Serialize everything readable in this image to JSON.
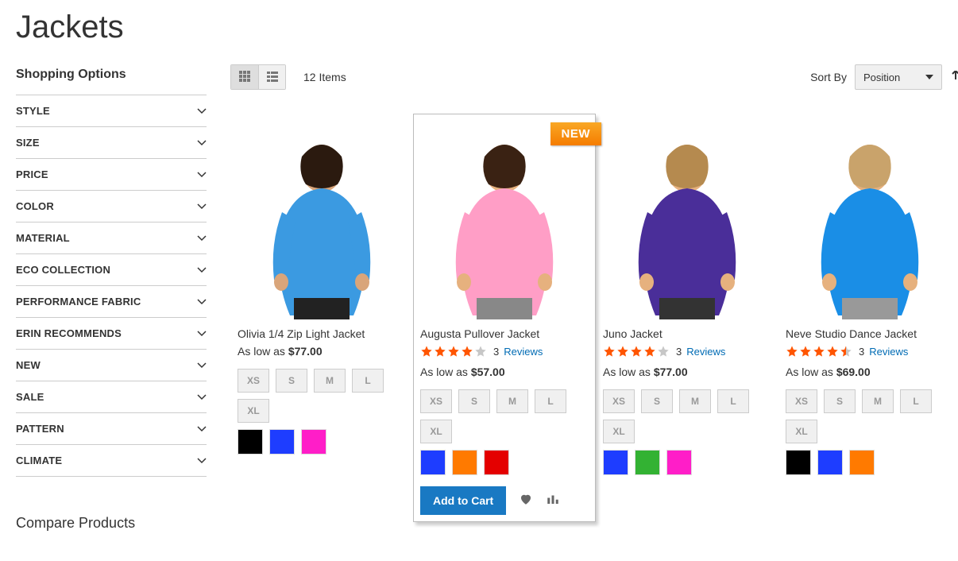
{
  "page_title": "Jackets",
  "sidebar": {
    "title": "Shopping Options",
    "filters": [
      "STYLE",
      "SIZE",
      "PRICE",
      "COLOR",
      "MATERIAL",
      "ECO COLLECTION",
      "PERFORMANCE FABRIC",
      "ERIN RECOMMENDS",
      "NEW",
      "SALE",
      "PATTERN",
      "CLIMATE"
    ],
    "compare_title": "Compare Products"
  },
  "toolbar": {
    "item_count": "12 Items",
    "sort_label": "Sort By",
    "sort_value": "Position"
  },
  "labels": {
    "as_low_as": "As low as",
    "reviews": "Reviews",
    "add_to_cart": "Add to Cart",
    "new_badge": "NEW"
  },
  "products": [
    {
      "name": "Olivia 1/4 Zip Light Jacket",
      "price": "$77.00",
      "rating": null,
      "reviews": null,
      "sizes": [
        "XS",
        "S",
        "M",
        "L",
        "XL"
      ],
      "colors": [
        "#000000",
        "#1e3dff",
        "#ff1ec8"
      ],
      "hovered": false,
      "new": false,
      "image": {
        "shirt": "#3b9ae1",
        "pants": "#222",
        "face": "#d9a57a",
        "hair": "#2b1a0f"
      }
    },
    {
      "name": "Augusta Pullover Jacket",
      "price": "$57.00",
      "rating": 4,
      "reviews": 3,
      "sizes": [
        "XS",
        "S",
        "M",
        "L",
        "XL"
      ],
      "colors": [
        "#1e3dff",
        "#ff7a00",
        "#e40000"
      ],
      "hovered": true,
      "new": true,
      "image": {
        "shirt": "#ff9ec6",
        "pants": "#888",
        "face": "#e6b17e",
        "hair": "#3a2213"
      }
    },
    {
      "name": "Juno Jacket",
      "price": "$77.00",
      "rating": 4,
      "reviews": 3,
      "sizes": [
        "XS",
        "S",
        "M",
        "L",
        "XL"
      ],
      "colors": [
        "#1e3dff",
        "#33b233",
        "#ff1ec8"
      ],
      "hovered": false,
      "new": false,
      "image": {
        "shirt": "#4a2e99",
        "pants": "#333",
        "face": "#e6b17e",
        "hair": "#b58a4f"
      }
    },
    {
      "name": "Neve Studio Dance Jacket",
      "price": "$69.00",
      "rating": 4.5,
      "reviews": 3,
      "sizes": [
        "XS",
        "S",
        "M",
        "L",
        "XL"
      ],
      "colors": [
        "#000000",
        "#1e3dff",
        "#ff7a00"
      ],
      "hovered": false,
      "new": false,
      "image": {
        "shirt": "#1a8ee6",
        "pants": "#999",
        "face": "#e6b17e",
        "hair": "#c9a36b"
      }
    }
  ]
}
